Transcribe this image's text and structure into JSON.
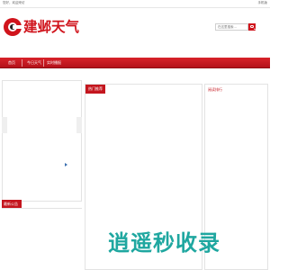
{
  "topbar": {
    "left_text": "您好，欢迎来访",
    "right_text": "手机版"
  },
  "logo": {
    "text": "建邺天气"
  },
  "search": {
    "placeholder": "在这里搜索...",
    "button_icon": "search-icon"
  },
  "nav": {
    "items": [
      "首页",
      "今日天气",
      "实时播报"
    ]
  },
  "sidebar": {
    "section_title": "最新公告"
  },
  "main": {
    "panel_hot": {
      "title": "热门推荐"
    },
    "panel_rank": {
      "title": "阅读排行"
    }
  },
  "watermark": {
    "text": "逍遥秒收录"
  },
  "colors": {
    "brand_red": "#d0141c",
    "watermark": "#1fa7a0"
  }
}
